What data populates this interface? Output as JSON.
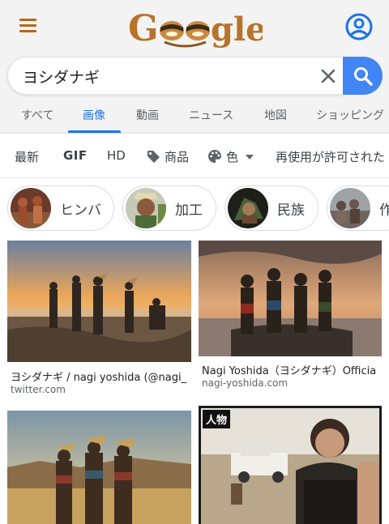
{
  "header": {
    "logo_text": "Google",
    "menu_icon": "hamburger-menu-icon",
    "account_icon": "account-circle-icon"
  },
  "search": {
    "query": "ヨシダナギ",
    "clear_icon": "close-icon",
    "search_icon": "search-icon"
  },
  "tabs": [
    {
      "label": "すべて"
    },
    {
      "label": "画像",
      "active": true
    },
    {
      "label": "動画"
    },
    {
      "label": "ニュース"
    },
    {
      "label": "地図"
    },
    {
      "label": "ショッピング"
    }
  ],
  "filters": [
    {
      "label": "最新"
    },
    {
      "label": "GIF"
    },
    {
      "label": "HD"
    },
    {
      "label": "商品",
      "icon": "tag-icon"
    },
    {
      "label": "色",
      "icon": "palette-icon"
    },
    {
      "label": "再使用が許可された"
    }
  ],
  "chips": [
    {
      "label": "ヒンバ"
    },
    {
      "label": "加工"
    },
    {
      "label": "民族"
    },
    {
      "label": "作"
    }
  ],
  "results": [
    {
      "caption": "ヨシダナギ / nagi yoshida (@nagi_",
      "source": "twitter.com"
    },
    {
      "caption": "Nagi Yoshida（ヨシダナギ）Officia",
      "source": "nagi-yoshida.com"
    },
    {
      "caption": "",
      "source": "",
      "tag": ""
    },
    {
      "caption": "",
      "source": "",
      "tag": "人物"
    }
  ],
  "colors": {
    "accent": "#1a73e8",
    "search_button": "#4285f4",
    "menu": "#b3691e",
    "topbar_bg": "#f3f3f3"
  }
}
